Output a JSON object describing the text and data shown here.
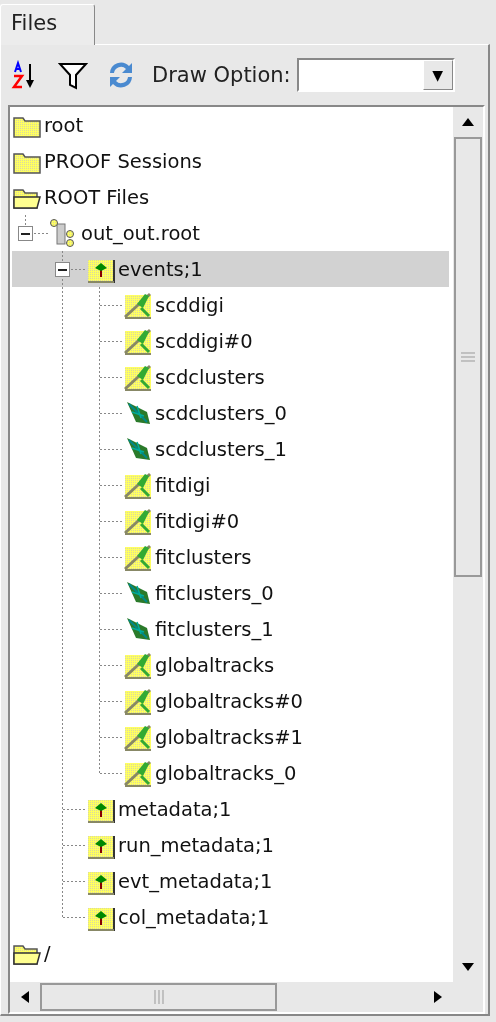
{
  "tabs": [
    {
      "label": "Files",
      "selected": true
    }
  ],
  "toolbar": {
    "draw_option_label": "Draw Option:",
    "draw_option_dropdown_glyph": "▼"
  },
  "tree": [
    {
      "label": "root",
      "kind": "folder",
      "selected": false
    },
    {
      "label": "PROOF Sessions",
      "kind": "folder",
      "selected": false
    },
    {
      "label": "ROOT Files",
      "kind": "open-folder",
      "selected": false,
      "children": [
        {
          "label": "out_out.root",
          "kind": "file",
          "selected": false,
          "expanded": true,
          "children": [
            {
              "label": "events;1",
              "kind": "tree",
              "selected": true,
              "expanded": true,
              "children": [
                {
                  "label": "scddigi",
                  "kind": "branch",
                  "selected": false
                },
                {
                  "label": "scddigi#0",
                  "kind": "branch",
                  "selected": false
                },
                {
                  "label": "scdclusters",
                  "kind": "branch",
                  "selected": false
                },
                {
                  "label": "scdclusters_0",
                  "kind": "leaf",
                  "selected": false
                },
                {
                  "label": "scdclusters_1",
                  "kind": "leaf",
                  "selected": false
                },
                {
                  "label": "fitdigi",
                  "kind": "branch",
                  "selected": false
                },
                {
                  "label": "fitdigi#0",
                  "kind": "branch",
                  "selected": false
                },
                {
                  "label": "fitclusters",
                  "kind": "branch",
                  "selected": false
                },
                {
                  "label": "fitclusters_0",
                  "kind": "leaf",
                  "selected": false
                },
                {
                  "label": "fitclusters_1",
                  "kind": "leaf",
                  "selected": false
                },
                {
                  "label": "globaltracks",
                  "kind": "branch",
                  "selected": false
                },
                {
                  "label": "globaltracks#0",
                  "kind": "branch",
                  "selected": false
                },
                {
                  "label": "globaltracks#1",
                  "kind": "branch",
                  "selected": false
                },
                {
                  "label": "globaltracks_0",
                  "kind": "branch",
                  "selected": false
                }
              ]
            },
            {
              "label": "metadata;1",
              "kind": "tree",
              "selected": false
            },
            {
              "label": "run_metadata;1",
              "kind": "tree",
              "selected": false
            },
            {
              "label": "evt_metadata;1",
              "kind": "tree",
              "selected": false
            },
            {
              "label": "col_metadata;1",
              "kind": "tree",
              "selected": false
            }
          ]
        }
      ]
    },
    {
      "label": "/",
      "kind": "open-folder",
      "selected": false
    }
  ]
}
